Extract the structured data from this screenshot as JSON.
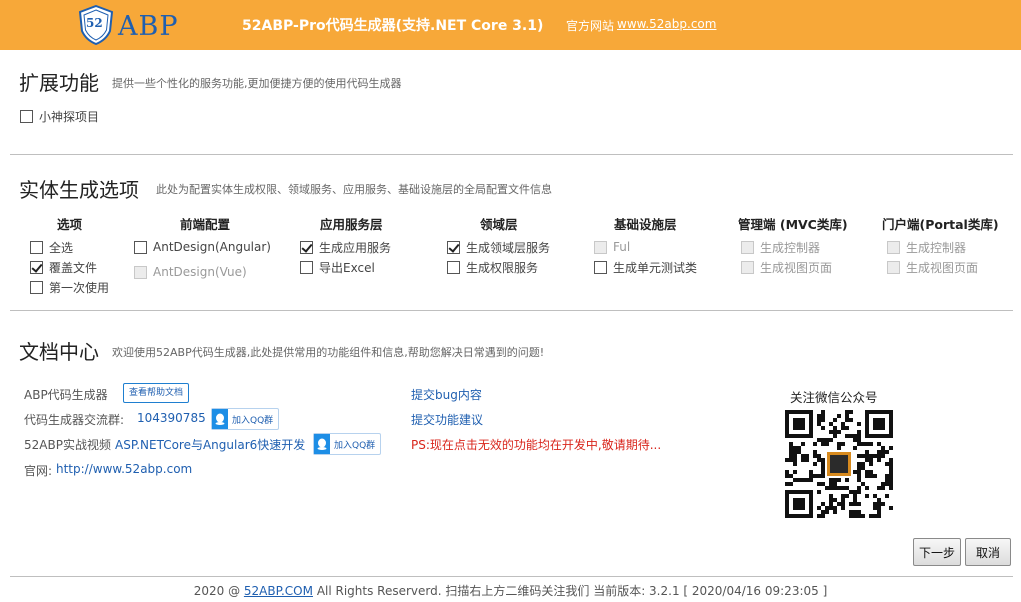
{
  "header": {
    "logo_text": "ABP",
    "logo_badge": "52",
    "app_title": "52ABP-Pro代码生成器(支持.NET Core 3.1)",
    "site_label": "官方网站",
    "site_link": "www.52abp.com",
    "background": "#f7a839"
  },
  "extensions": {
    "title": "扩展功能",
    "desc": "提供一些个性化的服务功能,更加便捷方便的使用代码生成器",
    "items": [
      {
        "label": "小神探项目",
        "checked": false
      }
    ]
  },
  "entity": {
    "title": "实体生成选项",
    "desc": "此处为配置实体生成权限、领域服务、应用服务、基础设施层的全局配置文件信息",
    "columns": [
      {
        "header": "选项",
        "items": [
          {
            "label": "全选",
            "checked": false,
            "disabled": false
          },
          {
            "label": "覆盖文件",
            "checked": true,
            "disabled": false
          },
          {
            "label": "第一次使用",
            "checked": false,
            "disabled": false
          }
        ]
      },
      {
        "header": "前端配置",
        "items": [
          {
            "label": "AntDesign(Angular)",
            "checked": false,
            "disabled": false
          },
          {
            "label": "AntDesign(Vue)",
            "checked": false,
            "disabled": true
          }
        ]
      },
      {
        "header": "应用服务层",
        "items": [
          {
            "label": "生成应用服务",
            "checked": true,
            "disabled": false
          },
          {
            "label": "导出Excel",
            "checked": false,
            "disabled": false
          }
        ]
      },
      {
        "header": "领域层",
        "items": [
          {
            "label": "生成领域层服务",
            "checked": true,
            "disabled": false
          },
          {
            "label": "生成权限服务",
            "checked": false,
            "disabled": false
          }
        ]
      },
      {
        "header": "基础设施层",
        "items": [
          {
            "label": "Ful",
            "checked": false,
            "disabled": true
          },
          {
            "label": "生成单元测试类",
            "checked": false,
            "disabled": false
          }
        ]
      },
      {
        "header": "管理端 (MVC类库)",
        "items": [
          {
            "label": "生成控制器",
            "checked": false,
            "disabled": true
          },
          {
            "label": "生成视图页面",
            "checked": false,
            "disabled": true
          }
        ]
      },
      {
        "header": "门户端(Portal类库)",
        "items": [
          {
            "label": "生成控制器",
            "checked": false,
            "disabled": true
          },
          {
            "label": "生成视图页面",
            "checked": false,
            "disabled": true
          }
        ]
      }
    ]
  },
  "docs": {
    "title": "文档中心",
    "desc": "欢迎使用52ABP代码生成器,此处提供常用的功能组件和信息,帮助您解决日常遇到的问题!",
    "abp_label": "ABP代码生成器",
    "help_button": "查看帮助文档",
    "group_label": "代码生成器交流群:",
    "group_number": "104390785",
    "join_qq": "加入QQ群",
    "video_label": "52ABP实战视频",
    "video_link": "ASP.NETCore与Angular6快速开发",
    "site_label": "官网:",
    "site_link": "http://www.52abp.com",
    "bug_link": "提交bug内容",
    "feature_link": "提交功能建议",
    "ps_text": "PS:现在点击无效的功能均在开发中,敬请期待...",
    "qr_title": "关注微信公众号"
  },
  "actions": {
    "next": "下一步",
    "cancel": "取消"
  },
  "footer": {
    "prefix": "2020 @",
    "brand": "52ABP.COM",
    "suffix": "All Rights Reserverd. 扫描右上方二维码关注我们 当前版本: 3.2.1 [ 2020/04/16 09:23:05 ]"
  },
  "colors": {
    "accent": "#f7a839",
    "link": "#1f5fb0",
    "warning": "#d9261c"
  }
}
